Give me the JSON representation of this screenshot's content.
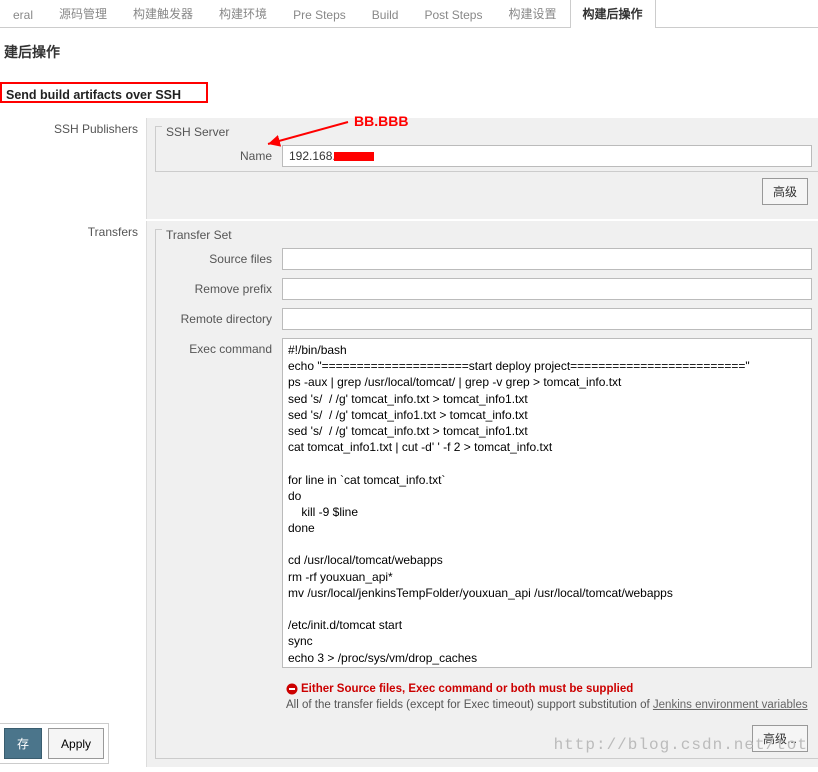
{
  "tabs": {
    "items": [
      "eral",
      "源码管理",
      "构建触发器",
      "构建环境",
      "Pre Steps",
      "Build",
      "Post Steps",
      "构建设置",
      "构建后操作"
    ],
    "active_index": 8
  },
  "section": {
    "title": "建后操作"
  },
  "ssh_over": {
    "label": "Send build artifacts over SSH"
  },
  "publishers": {
    "label": "SSH Publishers"
  },
  "server": {
    "legend": "SSH Server",
    "name_label": "Name",
    "name_value": "192.168.",
    "adv_button": "高级"
  },
  "annotation": {
    "bb": "BB.BBB"
  },
  "transfers": {
    "label": "Transfers",
    "legend": "Transfer Set",
    "source_label": "Source files",
    "source_value": "",
    "remove_label": "Remove prefix",
    "remove_value": "",
    "remote_label": "Remote directory",
    "remote_value": "",
    "exec_label": "Exec command",
    "exec_value": "#!/bin/bash\necho \"=====================start deploy project=========================\"\nps -aux | grep /usr/local/tomcat/ | grep -v grep > tomcat_info.txt\nsed 's/  / /g' tomcat_info.txt > tomcat_info1.txt\nsed 's/  / /g' tomcat_info1.txt > tomcat_info.txt\nsed 's/  / /g' tomcat_info.txt > tomcat_info1.txt\ncat tomcat_info1.txt | cut -d' ' -f 2 > tomcat_info.txt\n\nfor line in `cat tomcat_info.txt`\ndo\n    kill -9 $line\ndone\n\ncd /usr/local/tomcat/webapps\nrm -rf youxuan_api*\nmv /usr/local/jenkinsTempFolder/youxuan_api /usr/local/tomcat/webapps\n\n/etc/init.d/tomcat start\nsync\necho 3 > /proc/sys/vm/drop_caches\necho \"=====================deploy project success=========================\"",
    "adv_button": "高级..."
  },
  "help": {
    "error": "Either Source files, Exec command or both must be supplied",
    "text1": "All of the transfer fields (except for Exec timeout) support substitution of ",
    "link": "Jenkins environment variables"
  },
  "footer": {
    "save": "存",
    "apply": "Apply"
  },
  "watermark": "http://blog.csdn.net/tot"
}
